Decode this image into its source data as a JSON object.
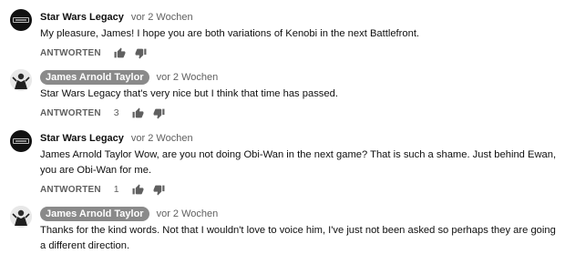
{
  "comments": [
    {
      "author": "Star Wars Legacy",
      "author_highlight": false,
      "time": "vor 2 Wochen",
      "text": "My pleasure, James! I hope you are both variations of Kenobi in the next Battlefront.",
      "reply_label": "ANTWORTEN",
      "likes": ""
    },
    {
      "author": "James Arnold Taylor",
      "author_highlight": true,
      "time": "vor 2 Wochen",
      "text": "Star Wars Legacy that's very nice but I think that time has passed.",
      "reply_label": "ANTWORTEN",
      "likes": "3"
    },
    {
      "author": "Star Wars Legacy",
      "author_highlight": false,
      "time": "vor 2 Wochen",
      "text": "James Arnold Taylor Wow, are you not doing Obi-Wan in the next game? That is such a shame. Just behind Ewan, you are Obi-Wan for me.",
      "reply_label": "ANTWORTEN",
      "likes": "1"
    },
    {
      "author": "James Arnold Taylor",
      "author_highlight": true,
      "time": "vor 2 Wochen",
      "text": "Thanks for the kind words.  Not that I wouldn't love to voice him, I've just not been asked so perhaps they are going a different direction.",
      "reply_label": "",
      "likes": ""
    }
  ],
  "colors": {
    "text": "#0f0f0f",
    "secondary": "#606060",
    "author_pill": "#8a8a8a"
  },
  "icons": {
    "like": "thumbs-up-icon",
    "dislike": "thumbs-down-icon"
  }
}
